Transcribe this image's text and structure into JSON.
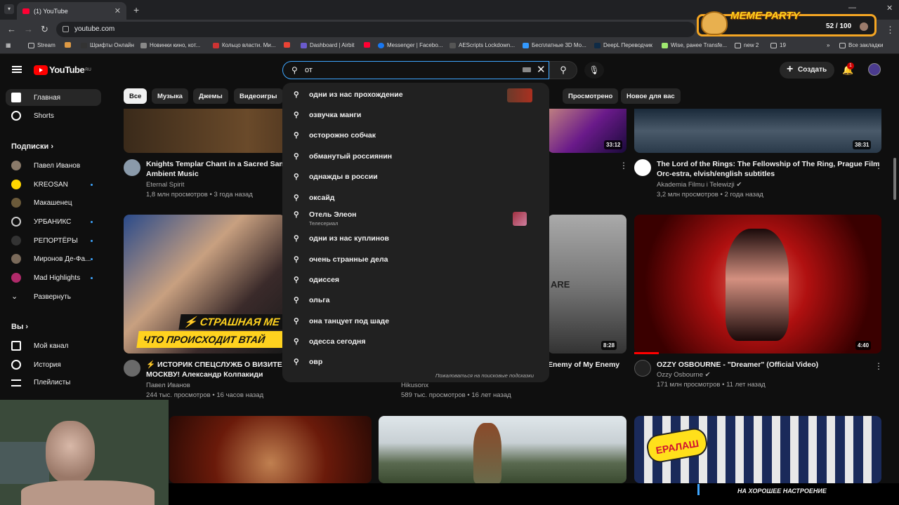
{
  "browser": {
    "tab_title": "(1) YouTube",
    "url": "youtube.com",
    "bookmarks": [
      "Stream",
      "Шрифты Онлайн",
      "Новинки кино, кот...",
      "Кольцо власти. Ми...",
      "Dashboard | Airbit",
      "Messenger | Facebo...",
      "AEScripts Lockdown...",
      "Бесплатные 3D Мо...",
      "DeepL Переводчик",
      "Wise, ранее Transfe...",
      "new 2",
      "19"
    ],
    "all_bookmarks": "Все закладки"
  },
  "overlay": {
    "title": "MEME PARTY",
    "count": "52 / 100",
    "banner_text": "НА ХОРОШЕЕ НАСТРОЕНИЕ"
  },
  "header": {
    "logo": "YouTube",
    "logo_region": "RU",
    "search_value": "от",
    "create_label": "Создать",
    "notif_count": "1"
  },
  "chips": [
    "Все",
    "Музыка",
    "Джемы",
    "Видеоигры",
    "Просмотрено",
    "Новое для вас"
  ],
  "sidebar": {
    "home": "Главная",
    "shorts": "Shorts",
    "subs_header": "Подписки",
    "subs": [
      "Павел Иванов",
      "KREOSAN",
      "Макашенец",
      "УРБАНИКС",
      "РЕПОРТЁРЫ",
      "Миронов Де-Фа...",
      "Mad Highlights"
    ],
    "expand": "Развернуть",
    "you_header": "Вы",
    "you": [
      "Мой канал",
      "История",
      "Плейлисты"
    ]
  },
  "suggestions": [
    "одни из нас прохождение",
    "озвучка манги",
    "осторожно собчак",
    "обманутый россиянин",
    "однажды в россии",
    "оксайд",
    "Отель Элеон",
    "одни из нас куплинов",
    "очень странные дела",
    "одиссея",
    "ольга",
    "она танцует под шаде",
    "одесса сегодня",
    "овр"
  ],
  "suggestion_sub": "Телесериал",
  "report_label": "Пожаловаться на поисковые подсказки",
  "videos": {
    "v1": {
      "title1": "Knights Templar Chant in a Sacred Sanct",
      "title2": "Ambient Music",
      "channel": "Eternal Spirit",
      "meta": "1,8 млн просмотров • 3 года назад"
    },
    "v2": {
      "duration": "33:12"
    },
    "v3": {
      "title1": "The Lord of the Rings: The Fellowship of The Ring, Prague Film",
      "title2": "Orc-estra, elvish/english subtitles",
      "channel": "Akademia Filmu i Telewizji",
      "meta": "3,2 млн просмотров • 2 года назад",
      "duration": "38:31"
    },
    "v4": {
      "title1": "⚡ ИСТОРИК СПЕЦСЛУЖБ О ВИЗИТЕ П",
      "title2": "МОСКВУ! Александр Колпакиди",
      "channel": "Павел Иванов",
      "meta": "244 тыс. просмотров • 16 часов назад",
      "thumb_text1": "⚡ СТРАШНАЯ МЕ",
      "thumb_text2": "ЧТО ПРОИСХОДИТ ВТАЙ"
    },
    "v5": {
      "title1": "Enemy of My Enemy",
      "channel": "Hikusonx",
      "meta": "589 тыс. просмотров • 16 лет назад",
      "duration": "8:28"
    },
    "v6": {
      "title1": "OZZY OSBOURNE - \"Dreamer\" (Official Video)",
      "channel": "Ozzy Osbourne",
      "meta": "171 млн просмотров • 11 лет назад",
      "duration": "4:40"
    }
  }
}
